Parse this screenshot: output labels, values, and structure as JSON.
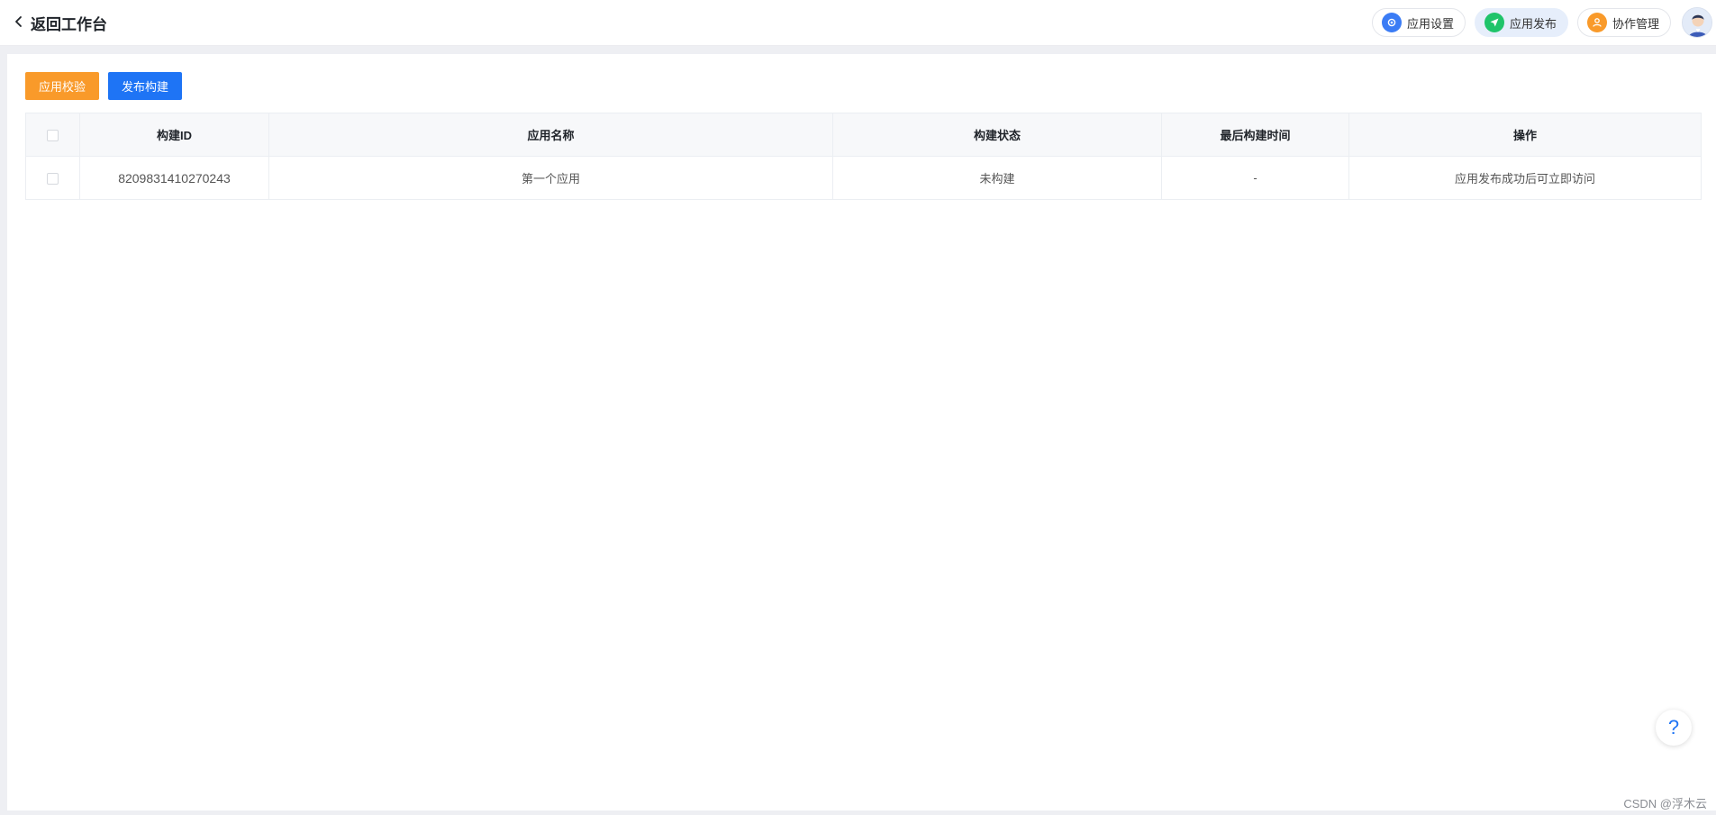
{
  "header": {
    "back_label": "返回工作台",
    "nav": [
      {
        "label": "应用设置",
        "icon": "settings-icon",
        "color": "#3b7cf5"
      },
      {
        "label": "应用发布",
        "icon": "send-icon",
        "color": "#1fc46a"
      },
      {
        "label": "协作管理",
        "icon": "users-icon",
        "color": "#f99a2a"
      }
    ],
    "avatar": "user-avatar"
  },
  "toolbar": {
    "validate_label": "应用校验",
    "publish_label": "发布构建"
  },
  "table": {
    "columns": [
      "构建ID",
      "应用名称",
      "构建状态",
      "最后构建时间",
      "操作"
    ],
    "rows": [
      {
        "build_id": "8209831410270243",
        "app_name": "第一个应用",
        "status": "未构建",
        "last_build_time": "-",
        "action": "应用发布成功后可立即访问"
      }
    ]
  },
  "help_label": "?",
  "watermark": "CSDN @浮木云",
  "colors": {
    "accent_blue": "#1e74f5",
    "accent_orange": "#f99a2a",
    "accent_green": "#1fc46a"
  }
}
